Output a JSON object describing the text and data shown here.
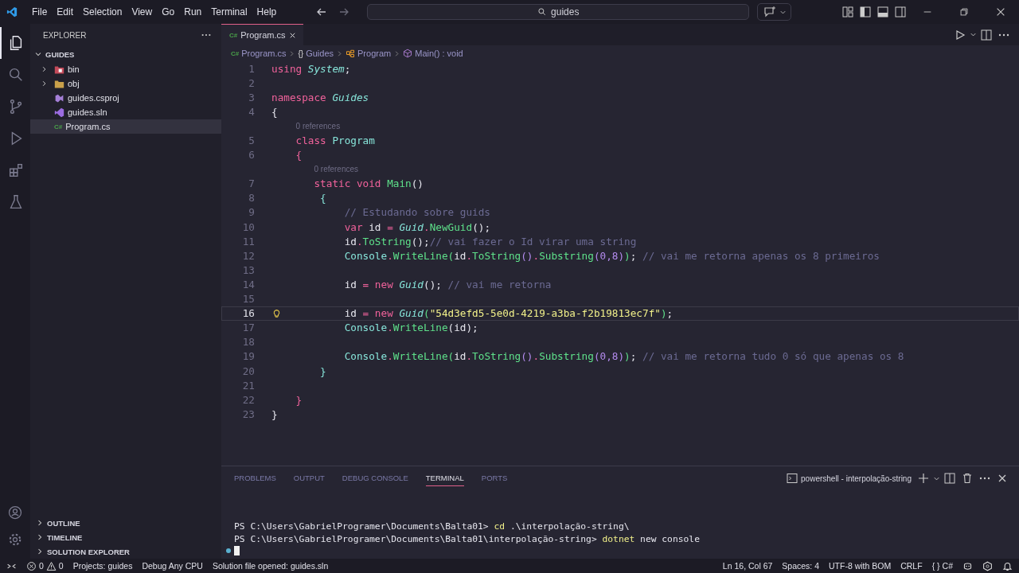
{
  "title_bar": {
    "menu": [
      "File",
      "Edit",
      "Selection",
      "View",
      "Go",
      "Run",
      "Terminal",
      "Help"
    ],
    "search": {
      "value": "guides"
    }
  },
  "activity_bar": [
    {
      "kind": "explorer",
      "selected": true
    },
    {
      "kind": "search",
      "selected": false
    },
    {
      "kind": "source-control",
      "selected": false
    },
    {
      "kind": "run-debug",
      "selected": false
    },
    {
      "kind": "extensions",
      "selected": false
    },
    {
      "kind": "testing",
      "selected": false
    }
  ],
  "sidebar": {
    "title": "EXPLORER",
    "section": "GUIDES",
    "items": [
      {
        "label": "bin",
        "kind": "folder-bin",
        "expanded": false,
        "selected": false
      },
      {
        "label": "obj",
        "kind": "folder",
        "expanded": false,
        "selected": false
      },
      {
        "label": "guides.csproj",
        "kind": "csproj",
        "selected": false
      },
      {
        "label": "guides.sln",
        "kind": "sln",
        "selected": false
      },
      {
        "label": "Program.cs",
        "kind": "cs",
        "icon": "C#",
        "selected": true
      }
    ],
    "bottom_sections": [
      "OUTLINE",
      "TIMELINE",
      "SOLUTION EXPLORER"
    ]
  },
  "editor": {
    "tabs": [
      {
        "label": "Program.cs",
        "icon": "C#",
        "selected": true
      }
    ],
    "breadcrumbs": [
      {
        "label": "Program.cs",
        "kind": "file",
        "icon": "C#"
      },
      {
        "label": "Guides",
        "kind": "namespace",
        "icon": "{}"
      },
      {
        "label": "Program",
        "kind": "class"
      },
      {
        "label": "Main() : void",
        "kind": "method"
      }
    ],
    "lines": [
      {
        "number": "1",
        "current": false,
        "tokens": [
          {
            "text": "using ",
            "kind": "k"
          },
          {
            "text": "System",
            "kind": "ti"
          },
          {
            "text": ";",
            "kind": "p"
          }
        ]
      },
      {
        "number": "2",
        "current": false
      },
      {
        "number": "3",
        "current": false,
        "tokens": [
          {
            "text": "namespace ",
            "kind": "k"
          },
          {
            "text": "Guides",
            "kind": "ti"
          }
        ]
      },
      {
        "number": "4",
        "current": false,
        "tokens": [
          {
            "text": "{",
            "kind": "p"
          }
        ]
      },
      {
        "number": "5",
        "current": false,
        "codelens": "0 references",
        "tokens": [
          {
            "text": "    class ",
            "kind": "k"
          },
          {
            "text": "Program",
            "kind": "t"
          }
        ]
      },
      {
        "number": "6",
        "current": false,
        "tokens": [
          {
            "text": "    {",
            "kind": "bp"
          }
        ]
      },
      {
        "number": "7",
        "current": false,
        "codelens": "0 references",
        "tokens": [
          {
            "text": "       static void ",
            "kind": "k"
          },
          {
            "text": "Main",
            "kind": "f"
          },
          {
            "text": "()",
            "kind": "p"
          }
        ]
      },
      {
        "number": "8",
        "current": false,
        "tokens": [
          {
            "text": "        {",
            "kind": "bt"
          }
        ]
      },
      {
        "number": "9",
        "current": false,
        "tokens": [
          {
            "text": "            // Estudando sobre guids",
            "kind": "c"
          }
        ]
      },
      {
        "number": "10",
        "current": false,
        "tokens": [
          {
            "text": "            var",
            "kind": "k"
          },
          {
            "text": " id ",
            "kind": "p"
          },
          {
            "text": "=",
            "kind": "o"
          },
          {
            "text": " Guid",
            "kind": "ti"
          },
          {
            "text": ".",
            "kind": "o"
          },
          {
            "text": "NewGuid",
            "kind": "f"
          },
          {
            "text": "();",
            "kind": "p"
          }
        ]
      },
      {
        "number": "11",
        "current": false,
        "tokens": [
          {
            "text": "            id",
            "kind": "p"
          },
          {
            "text": ".",
            "kind": "o"
          },
          {
            "text": "ToString",
            "kind": "f"
          },
          {
            "text": "();",
            "kind": "p"
          },
          {
            "text": "// vai fazer o Id virar uma string",
            "kind": "c"
          }
        ]
      },
      {
        "number": "12",
        "current": false,
        "tokens": [
          {
            "text": "            Console",
            "kind": "t"
          },
          {
            "text": ".",
            "kind": "o"
          },
          {
            "text": "WriteLine",
            "kind": "f"
          },
          {
            "text": "(",
            "kind": "bg"
          },
          {
            "text": "id",
            "kind": "p"
          },
          {
            "text": ".",
            "kind": "o"
          },
          {
            "text": "ToString",
            "kind": "f"
          },
          {
            "text": "()",
            "kind": "bv"
          },
          {
            "text": ".",
            "kind": "o"
          },
          {
            "text": "Substring",
            "kind": "f"
          },
          {
            "text": "(0,8)",
            "kind": "bv"
          },
          {
            "text": ")",
            "kind": "bg"
          },
          {
            "text": "; ",
            "kind": "p"
          },
          {
            "text": "// vai me retorna apenas os 8 primeiros",
            "kind": "c"
          }
        ]
      },
      {
        "number": "13",
        "current": false
      },
      {
        "number": "14",
        "current": false,
        "tokens": [
          {
            "text": "            id ",
            "kind": "p"
          },
          {
            "text": "=",
            "kind": "o"
          },
          {
            "text": " new",
            "kind": "k"
          },
          {
            "text": " Guid",
            "kind": "ti"
          },
          {
            "text": "(); ",
            "kind": "p"
          },
          {
            "text": "// vai me retorna",
            "kind": "c"
          }
        ]
      },
      {
        "number": "15",
        "current": false
      },
      {
        "number": "16",
        "current": true,
        "tokens": [
          {
            "text": "            id ",
            "kind": "p"
          },
          {
            "text": "=",
            "kind": "o"
          },
          {
            "text": " new",
            "kind": "k"
          },
          {
            "text": " Guid",
            "kind": "ti"
          },
          {
            "text": "(",
            "kind": "bg"
          },
          {
            "text": "\"54d3efd5-5e0d-4219-a3ba-f2b19813ec7f\"",
            "kind": "s"
          },
          {
            "text": ")",
            "kind": "bg"
          },
          {
            "text": ";",
            "kind": "p"
          }
        ]
      },
      {
        "number": "17",
        "current": false,
        "tokens": [
          {
            "text": "            Console",
            "kind": "t"
          },
          {
            "text": ".",
            "kind": "o"
          },
          {
            "text": "WriteLine",
            "kind": "f"
          },
          {
            "text": "(id);",
            "kind": "p"
          }
        ]
      },
      {
        "number": "18",
        "current": false
      },
      {
        "number": "19",
        "current": false,
        "tokens": [
          {
            "text": "            Console",
            "kind": "t"
          },
          {
            "text": ".",
            "kind": "o"
          },
          {
            "text": "WriteLine",
            "kind": "f"
          },
          {
            "text": "(",
            "kind": "bg"
          },
          {
            "text": "id",
            "kind": "p"
          },
          {
            "text": ".",
            "kind": "o"
          },
          {
            "text": "ToString",
            "kind": "f"
          },
          {
            "text": "()",
            "kind": "bv"
          },
          {
            "text": ".",
            "kind": "o"
          },
          {
            "text": "Substring",
            "kind": "f"
          },
          {
            "text": "(0,8)",
            "kind": "bv"
          },
          {
            "text": ")",
            "kind": "bg"
          },
          {
            "text": "; ",
            "kind": "p"
          },
          {
            "text": "// vai me retorna tudo 0 só que apenas os 8",
            "kind": "c"
          }
        ]
      },
      {
        "number": "20",
        "current": false,
        "tokens": [
          {
            "text": "        }",
            "kind": "bt"
          }
        ]
      },
      {
        "number": "21",
        "current": false
      },
      {
        "number": "22",
        "current": false,
        "tokens": [
          {
            "text": "    }",
            "kind": "bp"
          }
        ]
      },
      {
        "number": "23",
        "current": false,
        "tokens": [
          {
            "text": "}",
            "kind": "p"
          }
        ]
      }
    ]
  },
  "panel": {
    "tabs": [
      {
        "label": "PROBLEMS",
        "selected": false
      },
      {
        "label": "OUTPUT",
        "selected": false
      },
      {
        "label": "DEBUG CONSOLE",
        "selected": false
      },
      {
        "label": "TERMINAL",
        "selected": true
      },
      {
        "label": "PORTS",
        "selected": false
      }
    ],
    "terminal_name": "powershell - interpolação-string",
    "lines": [
      [
        {
          "text": "PS C:\\Users\\GabrielProgramer\\Documents\\Balta01> ",
          "kind": "p"
        },
        {
          "text": "cd",
          "kind": "cmd"
        },
        {
          "text": " .\\interpolação-string\\",
          "kind": "p"
        }
      ],
      [
        {
          "text": "PS C:\\Users\\GabrielProgramer\\Documents\\Balta01\\interpolação-string> ",
          "kind": "p"
        },
        {
          "text": "dotnet",
          "kind": "cmd"
        },
        {
          "text": " new console",
          "kind": "p"
        }
      ]
    ]
  },
  "status_bar": {
    "errors": "0",
    "warnings": "0",
    "left": [
      "Projects: guides",
      "Debug Any CPU",
      "Solution file opened: guides.sln"
    ],
    "right": [
      "Ln 16, Col 67",
      "Spaces: 4",
      "UTF-8 with BOM",
      "CRLF"
    ],
    "language_icon": "{ }",
    "language": "C#"
  }
}
